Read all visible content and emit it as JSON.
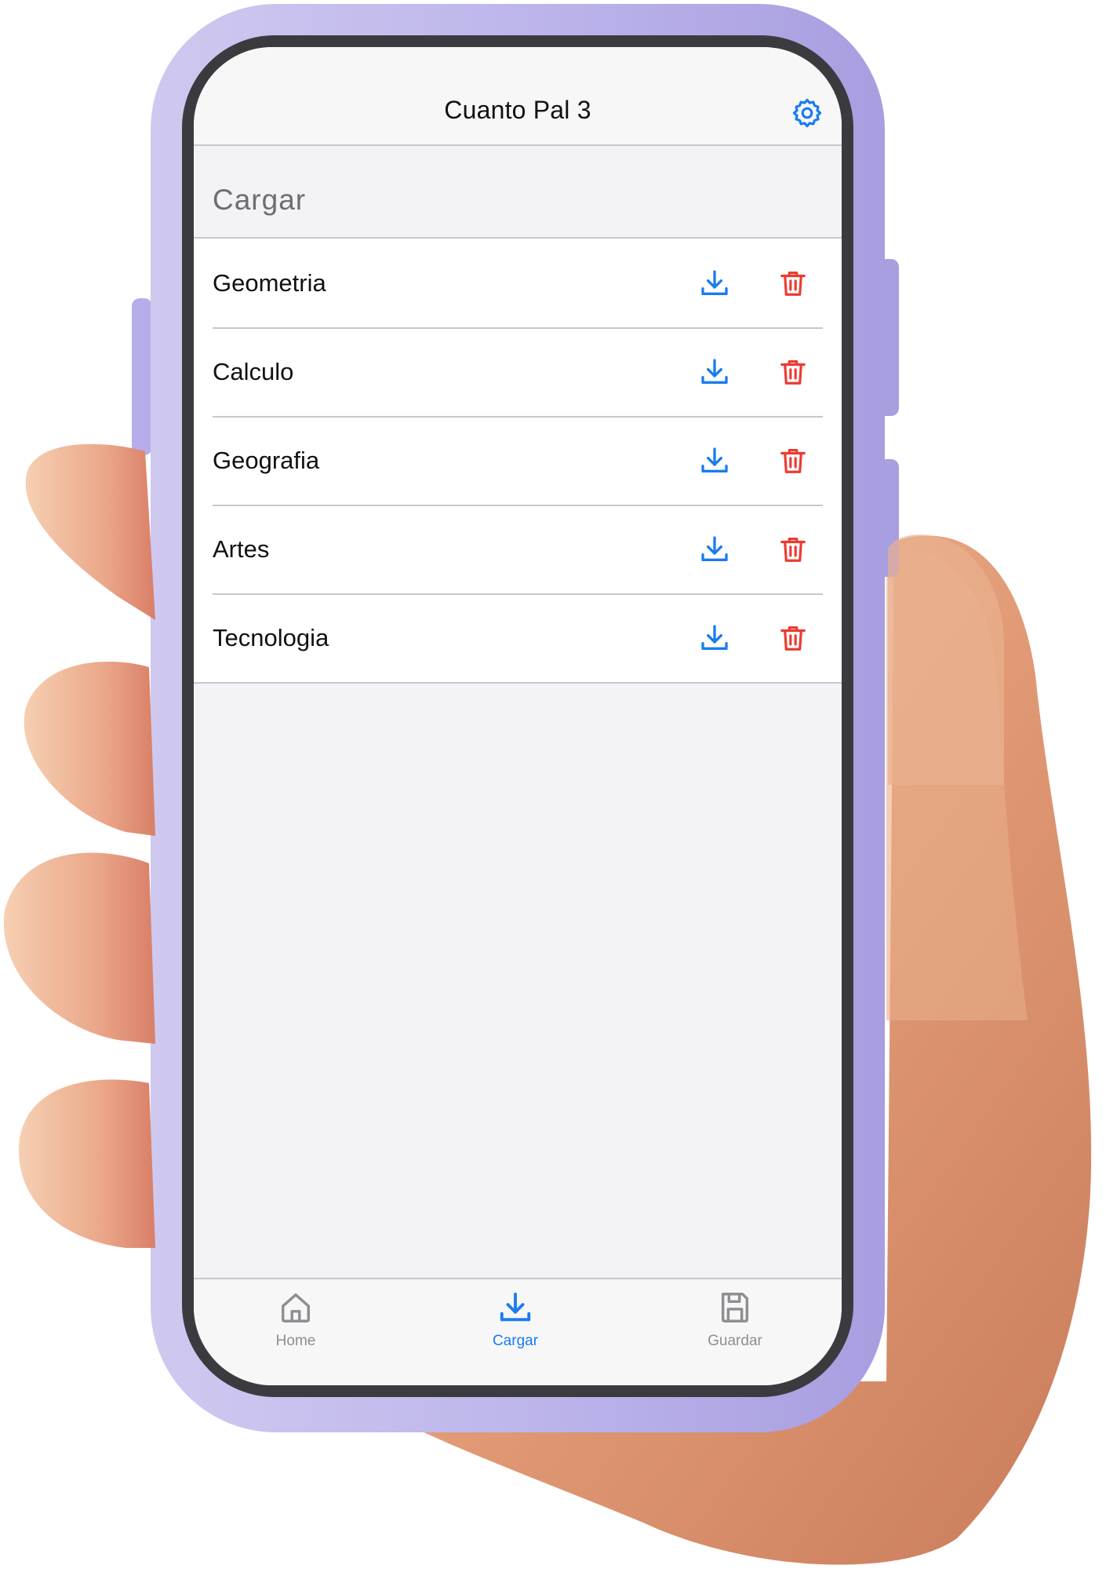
{
  "app": {
    "title": "Cuanto Pal 3"
  },
  "section": {
    "title": "Cargar"
  },
  "items": [
    {
      "label": "Geometria"
    },
    {
      "label": "Calculo"
    },
    {
      "label": "Geografia"
    },
    {
      "label": "Artes"
    },
    {
      "label": "Tecnologia"
    }
  ],
  "tabs": [
    {
      "label": "Home",
      "icon": "home-icon",
      "active": false
    },
    {
      "label": "Cargar",
      "icon": "download-icon",
      "active": true
    },
    {
      "label": "Guardar",
      "icon": "save-icon",
      "active": false
    }
  ],
  "colors": {
    "accent": "#1a7cf0",
    "danger": "#ec3b30",
    "inactive": "#8e8e93",
    "phone_case": "#b5aee3",
    "hand": "#e2a07c"
  }
}
